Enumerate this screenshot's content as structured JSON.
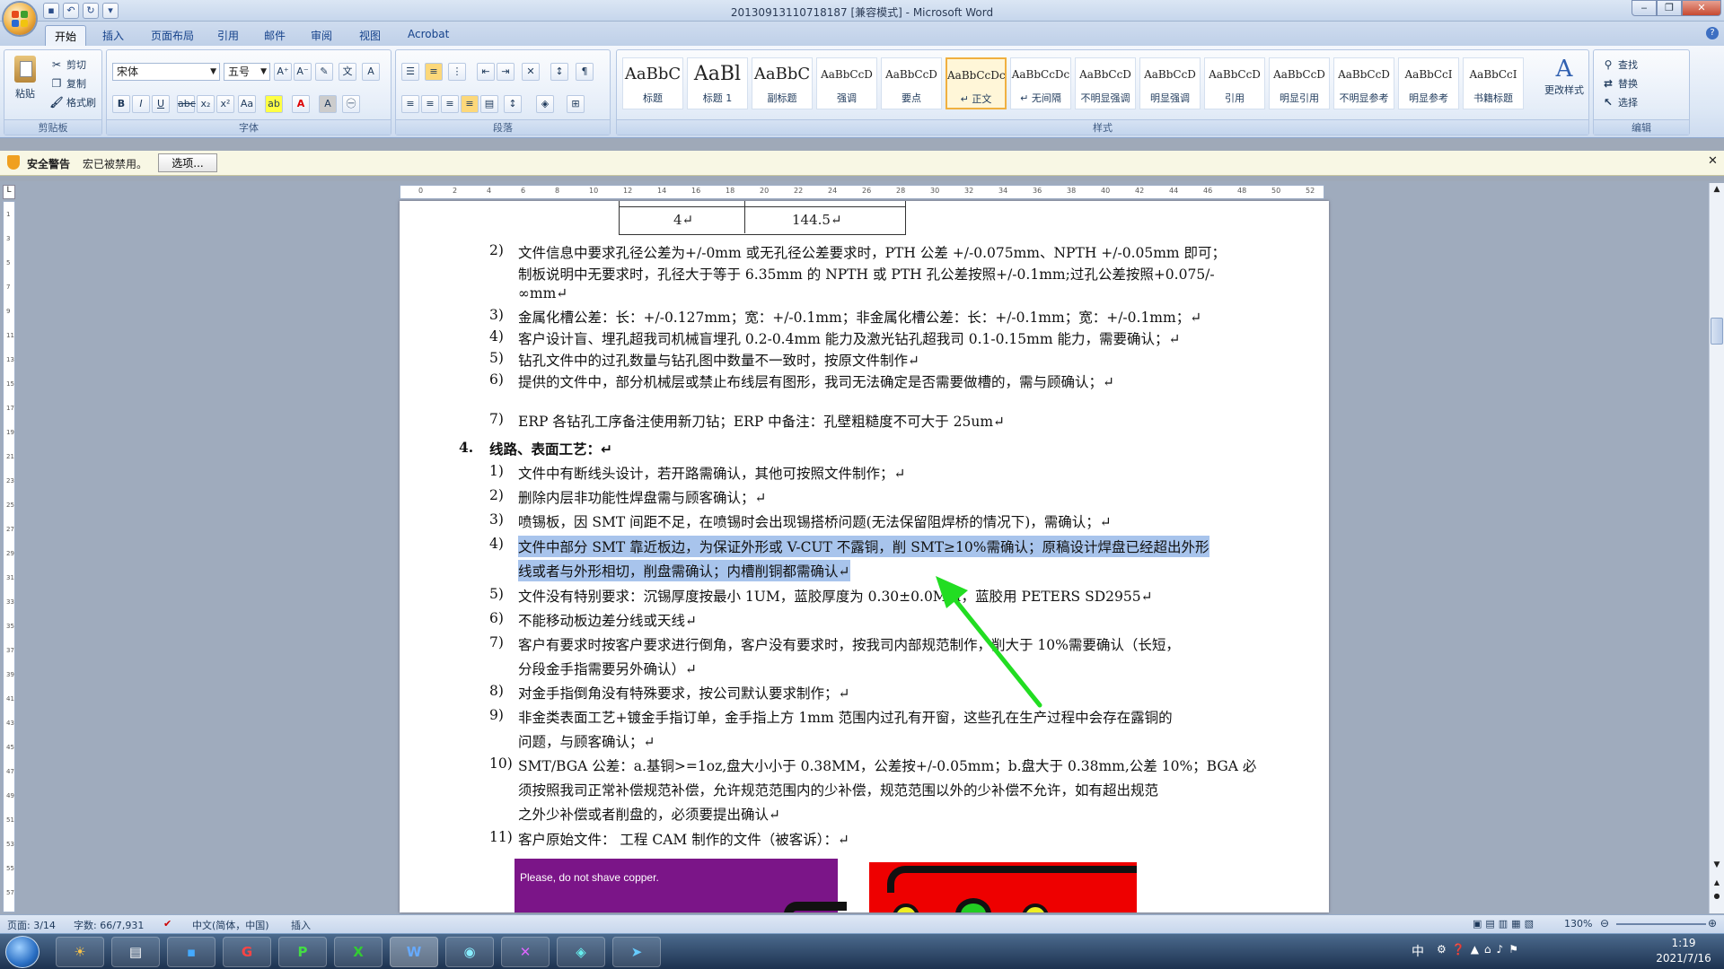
{
  "window": {
    "title": "20130913110718187 [兼容模式] - Microsoft Word"
  },
  "tabs": [
    "开始",
    "插入",
    "页面布局",
    "引用",
    "邮件",
    "审阅",
    "视图",
    "Acrobat"
  ],
  "ribbon": {
    "clipboard": {
      "paste": "粘贴",
      "cut": "剪切",
      "copy": "复制",
      "format_painter": "格式刷",
      "label": "剪贴板"
    },
    "font": {
      "name": "宋体",
      "size": "五号",
      "label": "字体"
    },
    "paragraph": {
      "label": "段落"
    },
    "styles": {
      "label": "样式",
      "items": [
        {
          "preview": "AaBbC",
          "name": "标题"
        },
        {
          "preview": "AaBl",
          "name": "标题 1"
        },
        {
          "preview": "AaBbC",
          "name": "副标题"
        },
        {
          "preview": "AaBbCcD",
          "name": "强调"
        },
        {
          "preview": "AaBbCcD",
          "name": "要点"
        },
        {
          "preview": "AaBbCcDc",
          "name": "↵ 正文"
        },
        {
          "preview": "AaBbCcDc",
          "name": "↵ 无间隔"
        },
        {
          "preview": "AaBbCcD",
          "name": "不明显强调"
        },
        {
          "preview": "AaBbCcD",
          "name": "明显强调"
        },
        {
          "preview": "AaBbCcD",
          "name": "引用"
        },
        {
          "preview": "AaBbCcD",
          "name": "明显引用"
        },
        {
          "preview": "AaBbCcD",
          "name": "不明显参考"
        },
        {
          "preview": "AaBbCcI",
          "name": "明显参考"
        },
        {
          "preview": "AaBbCcI",
          "name": "书籍标题"
        }
      ],
      "change": "更改样式"
    },
    "editing": {
      "find": "查找",
      "replace": "替换",
      "select": "选择",
      "label": "编辑"
    }
  },
  "security": {
    "label": "安全警告",
    "message": "宏已被禁用。",
    "options": "选项..."
  },
  "document": {
    "table_cells": [
      "4↵",
      "144.5↵"
    ],
    "lines": [
      {
        "n": "2)",
        "t": "文件信息中要求孔径公差为+/-0mm 或无孔径公差要求时，PTH 公差 +/-0.075mm、NPTH +/-0.05mm 即可；"
      },
      {
        "n": "",
        "t": "制板说明中无要求时，孔径大于等于 6.35mm 的 NPTH 或 PTH 孔公差按照+/-0.1mm;过孔公差按照+0.075/-"
      },
      {
        "n": "",
        "t": "∞mm↵"
      },
      {
        "n": "3)",
        "t": "金属化槽公差：长：+/-0.127mm；宽：+/-0.1mm；非金属化槽公差：长：+/-0.1mm；宽：+/-0.1mm；↵"
      },
      {
        "n": "4)",
        "t": "客户设计盲、埋孔超我司机械盲埋孔 0.2-0.4mm 能力及激光钻孔超我司 0.1-0.15mm 能力，需要确认；↵"
      },
      {
        "n": "5)",
        "t": "钻孔文件中的过孔数量与钻孔图中数量不一致时，按原文件制作↵"
      },
      {
        "n": "6)",
        "t": "提供的文件中，部分机械层或禁止布线层有图形，我司无法确定是否需要做槽的，需与顾确认；↵"
      },
      {
        "n": "7)",
        "t": "ERP 各钻孔工序备注使用新刀钻；ERP 中备注：孔壁粗糙度不可大于 25um↵"
      },
      {
        "n": "4.",
        "t": "线路、表面工艺：↵",
        "bold": true
      },
      {
        "n": "1)",
        "t": "文件中有断线头设计，若开路需确认，其他可按照文件制作；↵"
      },
      {
        "n": "2)",
        "t": "删除内层非功能性焊盘需与顾客确认；↵"
      },
      {
        "n": "3)",
        "t": "喷锡板，因 SMT 间距不足，在喷锡时会出现锡搭桥问题(无法保留阻焊桥的情况下)，需确认；↵"
      },
      {
        "n": "4)",
        "t": "文件中部分 SMT 靠近板边，为保证外形或 V-CUT 不露铜，削 SMT≥10%需确认；原稿设计焊盘已经超出外形",
        "hl": true
      },
      {
        "n": "",
        "t": "线或者与外形相切，削盘需确认；内槽削铜都需确认↵",
        "hl": true
      },
      {
        "n": "5)",
        "t": "文件没有特别要求：沉锡厚度按最小 1UM，蓝胶厚度为 0.30±0.0MM，蓝胶用 PETERS  SD2955↵"
      },
      {
        "n": "6)",
        "t": "不能移动板边差分线或天线↵"
      },
      {
        "n": "7)",
        "t": "客户有要求时按客户要求进行倒角，客户没有要求时，按我司内部规范制作，削大于 10%需要确认（长短，"
      },
      {
        "n": "",
        "t": "分段金手指需要另外确认）↵"
      },
      {
        "n": "8)",
        "t": "对金手指倒角没有特殊要求，按公司默认要求制作；↵"
      },
      {
        "n": "9)",
        "t": "非金类表面工艺+镀金手指订单，金手指上方 1mm 范围内过孔有开窗，这些孔在生产过程中会存在露铜的"
      },
      {
        "n": "",
        "t": "问题，与顾客确认；↵"
      },
      {
        "n": "10)",
        "t": "SMT/BGA 公差：a.基铜>=1oz,盘大小小于 0.38MM，公差按+/-0.05mm；b.盘大于 0.38mm,公差 10%；BGA 必"
      },
      {
        "n": "",
        "t": "须按照我司正常补偿规范补偿，允许规范范围内的少补偿，规范范围以外的少补偿不允许，如有超出规范"
      },
      {
        "n": "",
        "t": "之外少补偿或者削盘的，必须要提出确认↵"
      },
      {
        "n": "11)",
        "t": "客户原始文件：                 工程 CAM 制作的文件（被客诉）：↵"
      }
    ],
    "image_caption": "Please, do not shave copper."
  },
  "status": {
    "page": "页面: 3/14",
    "words": "字数: 66/7,931",
    "lang": "中文(简体，中国)",
    "mode": "插入",
    "zoom": "130%"
  },
  "taskbar": {
    "time": "1:19",
    "date": "2021/7/16",
    "ime": "中"
  },
  "colors": {
    "highlight": "#a8c4ec",
    "arrow": "#22dd22"
  }
}
